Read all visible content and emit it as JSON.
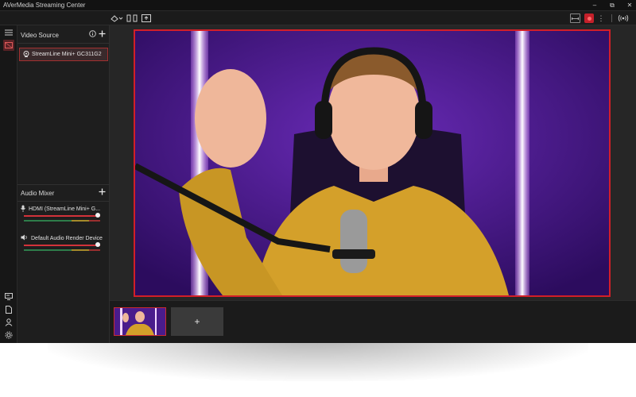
{
  "window": {
    "title": "AVerMedia Streaming Center",
    "controls": [
      "–",
      "⧉",
      "✕"
    ]
  },
  "toolbar": {
    "left_icons": [
      "layout-dropdown-icon",
      "split-view-icon",
      "screen-share-icon"
    ],
    "right_icons": [
      "fit-screen-icon",
      "record-icon",
      "more-menu-icon",
      "broadcast-icon"
    ],
    "more_glyph": "⋮"
  },
  "rail": {
    "icons": [
      "menu-icon",
      "scene-icon",
      "source-list-icon",
      "document-icon",
      "account-icon",
      "settings-icon"
    ]
  },
  "video_source": {
    "header": "Video Source",
    "items": [
      {
        "label": "StreamLine Mini+ GC311G2",
        "icon": "webcam-icon"
      }
    ]
  },
  "audio_mixer": {
    "header": "Audio Mixer",
    "channels": [
      {
        "label": "HDMI (StreamLine Mini+ G...",
        "icon": "microphone-icon",
        "volume": 1.0
      },
      {
        "label": "Default Audio Render Device",
        "icon": "speaker-icon",
        "volume": 1.0
      }
    ]
  },
  "scenes": {
    "add_label": "+"
  },
  "colors": {
    "accent": "#d21f28",
    "background": "#1b1b1b",
    "preview_bg": "#3a1470"
  }
}
